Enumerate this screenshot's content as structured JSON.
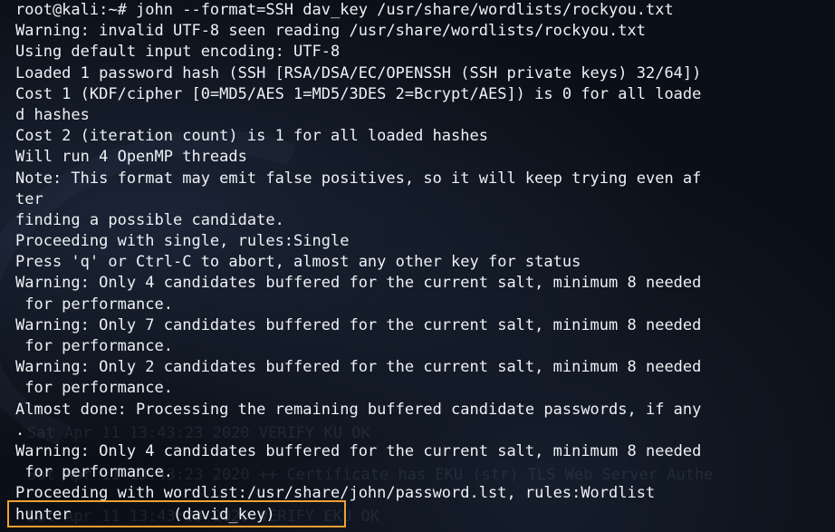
{
  "terminal": {
    "lines": [
      "root@kali:~# john --format=SSH dav_key /usr/share/wordlists/rockyou.txt",
      "Warning: invalid UTF-8 seen reading /usr/share/wordlists/rockyou.txt",
      "Using default input encoding: UTF-8",
      "Loaded 1 password hash (SSH [RSA/DSA/EC/OPENSSH (SSH private keys) 32/64])",
      "Cost 1 (KDF/cipher [0=MD5/AES 1=MD5/3DES 2=Bcrypt/AES]) is 0 for all loade",
      "d hashes",
      "Cost 2 (iteration count) is 1 for all loaded hashes",
      "Will run 4 OpenMP threads",
      "Note: This format may emit false positives, so it will keep trying even af",
      "ter",
      "finding a possible candidate.",
      "Proceeding with single, rules:Single",
      "Press 'q' or Ctrl-C to abort, almost any other key for status",
      "Warning: Only 4 candidates buffered for the current salt, minimum 8 needed",
      " for performance.",
      "Warning: Only 7 candidates buffered for the current salt, minimum 8 needed",
      " for performance.",
      "Warning: Only 2 candidates buffered for the current salt, minimum 8 needed",
      " for performance.",
      "Almost done: Processing the remaining buffered candidate passwords, if any",
      ".",
      "Warning: Only 4 candidates buffered for the current salt, minimum 8 needed",
      " for performance.",
      "Proceeding with wordlist:/usr/share/john/password.lst, rules:Wordlist",
      "hunter           (david_key)"
    ],
    "background_lines": [
      "Sat Apr 11 13:43:23 2020 VERIFY KU OK",
      "Sat Apr 11 13:43:23 2020 ++ Certificate has EKU (str) TLS Web Server Authe",
      "Sat Apr 11 13:43:23 2020 VERIFY EKU OK"
    ],
    "highlight_color": "#f0a030",
    "text_color": "#eef1f5",
    "background_color": "#0b0f17"
  }
}
